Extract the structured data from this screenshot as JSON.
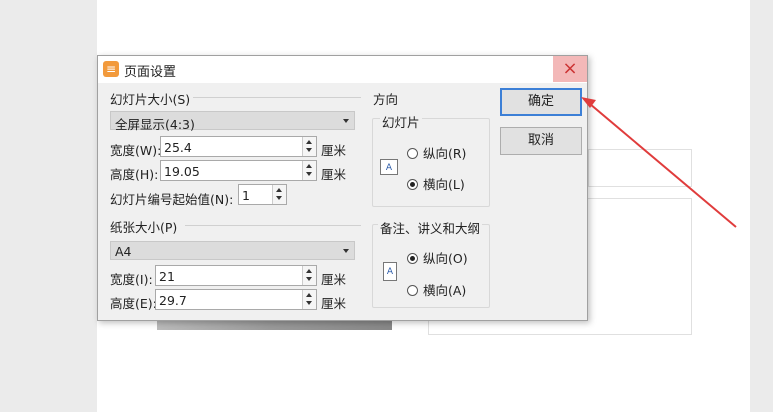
{
  "dialog": {
    "title": "页面设置",
    "close_glyph": "×",
    "slide_size": {
      "label": "幻灯片大小(S)",
      "preset": "全屏显示(4:3)",
      "width_label": "宽度(W):",
      "width_value": "25.4",
      "height_label": "高度(H):",
      "height_value": "19.05",
      "unit": "厘米",
      "start_number_label": "幻灯片编号起始值(N):",
      "start_number_value": "1"
    },
    "paper_size": {
      "label": "纸张大小(P)",
      "preset": "A4",
      "width_label": "宽度(I):",
      "width_value": "21",
      "height_label": "高度(E):",
      "height_value": "29.7",
      "unit": "厘米"
    },
    "orientation": {
      "label": "方向",
      "slides": {
        "label": "幻灯片",
        "portrait": "纵向(R)",
        "landscape": "横向(L)",
        "selected": "landscape"
      },
      "notes": {
        "label": "备注、讲义和大纲",
        "portrait": "纵向(O)",
        "landscape": "横向(A)",
        "selected": "portrait"
      }
    },
    "buttons": {
      "ok": "确定",
      "cancel": "取消"
    }
  },
  "colors": {
    "accent_arrow": "#e03c3c",
    "default_button_border": "#3c7fd6",
    "close_hover": "#f3b8b8"
  }
}
